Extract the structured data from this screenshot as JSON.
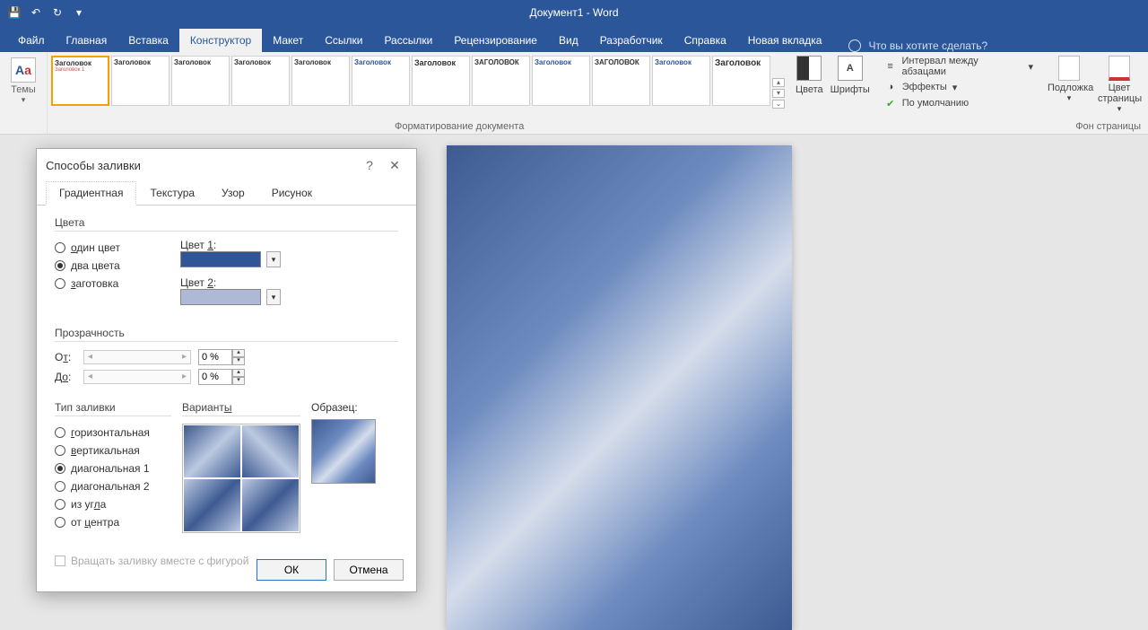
{
  "app": {
    "title": "Документ1 - Word"
  },
  "tabs": {
    "file": "Файл",
    "home": "Главная",
    "insert": "Вставка",
    "design": "Конструктор",
    "layout": "Макет",
    "references": "Ссылки",
    "mailings": "Рассылки",
    "review": "Рецензирование",
    "view": "Вид",
    "developer": "Разработчик",
    "help": "Справка",
    "newtab": "Новая вкладка",
    "tellme": "Что вы хотите сделать?"
  },
  "ribbon": {
    "themes": "Темы",
    "style_heading": "Заголовок",
    "style_heading_upper": "ЗАГОЛОВОК",
    "style_sub": "Заголовок 1",
    "doc_formatting": "Форматирование документа",
    "colors": "Цвета",
    "fonts": "Шрифты",
    "para_spacing": "Интервал между абзацами",
    "effects": "Эффекты",
    "set_default": "По умолчанию",
    "watermark": "Подложка",
    "page_color": "Цвет страницы",
    "page_bg_caption": "Фон страницы"
  },
  "dialog": {
    "title": "Способы заливки",
    "tabs": {
      "gradient": "Градиентная",
      "texture": "Текстура",
      "pattern": "Узор",
      "picture": "Рисунок"
    },
    "colors_label": "Цвета",
    "one_color": "один цвет",
    "one_color_u": "о",
    "two_colors": "два цвета",
    "two_colors_u": "д",
    "preset": "заготовка",
    "preset_u": "з",
    "color1": "Цвет 1:",
    "color1_u": "1",
    "color2": "Цвет 2:",
    "color2_u": "2",
    "c1_hex": "#2f5597",
    "c2_hex": "#adb9d5",
    "transparency": "Прозрачность",
    "from": "От:",
    "from_u": "т",
    "to": "До:",
    "to_u": "о",
    "pct": "0 %",
    "fill_type": "Тип заливки",
    "horiz": "горизонтальная",
    "horiz_u": "г",
    "vert": "вертикальная",
    "vert_u": "в",
    "diag1": "диагональная 1",
    "diag2": "диагональная 2",
    "corner": "из угла",
    "corner_u": "л",
    "center": "от центра",
    "center_u": "ц",
    "variants": "Варианты",
    "variants_u": "ы",
    "sample": "Образец:",
    "rotate": "Вращать заливку вместе с фигурой",
    "ok": "ОК",
    "cancel": "Отмена"
  }
}
